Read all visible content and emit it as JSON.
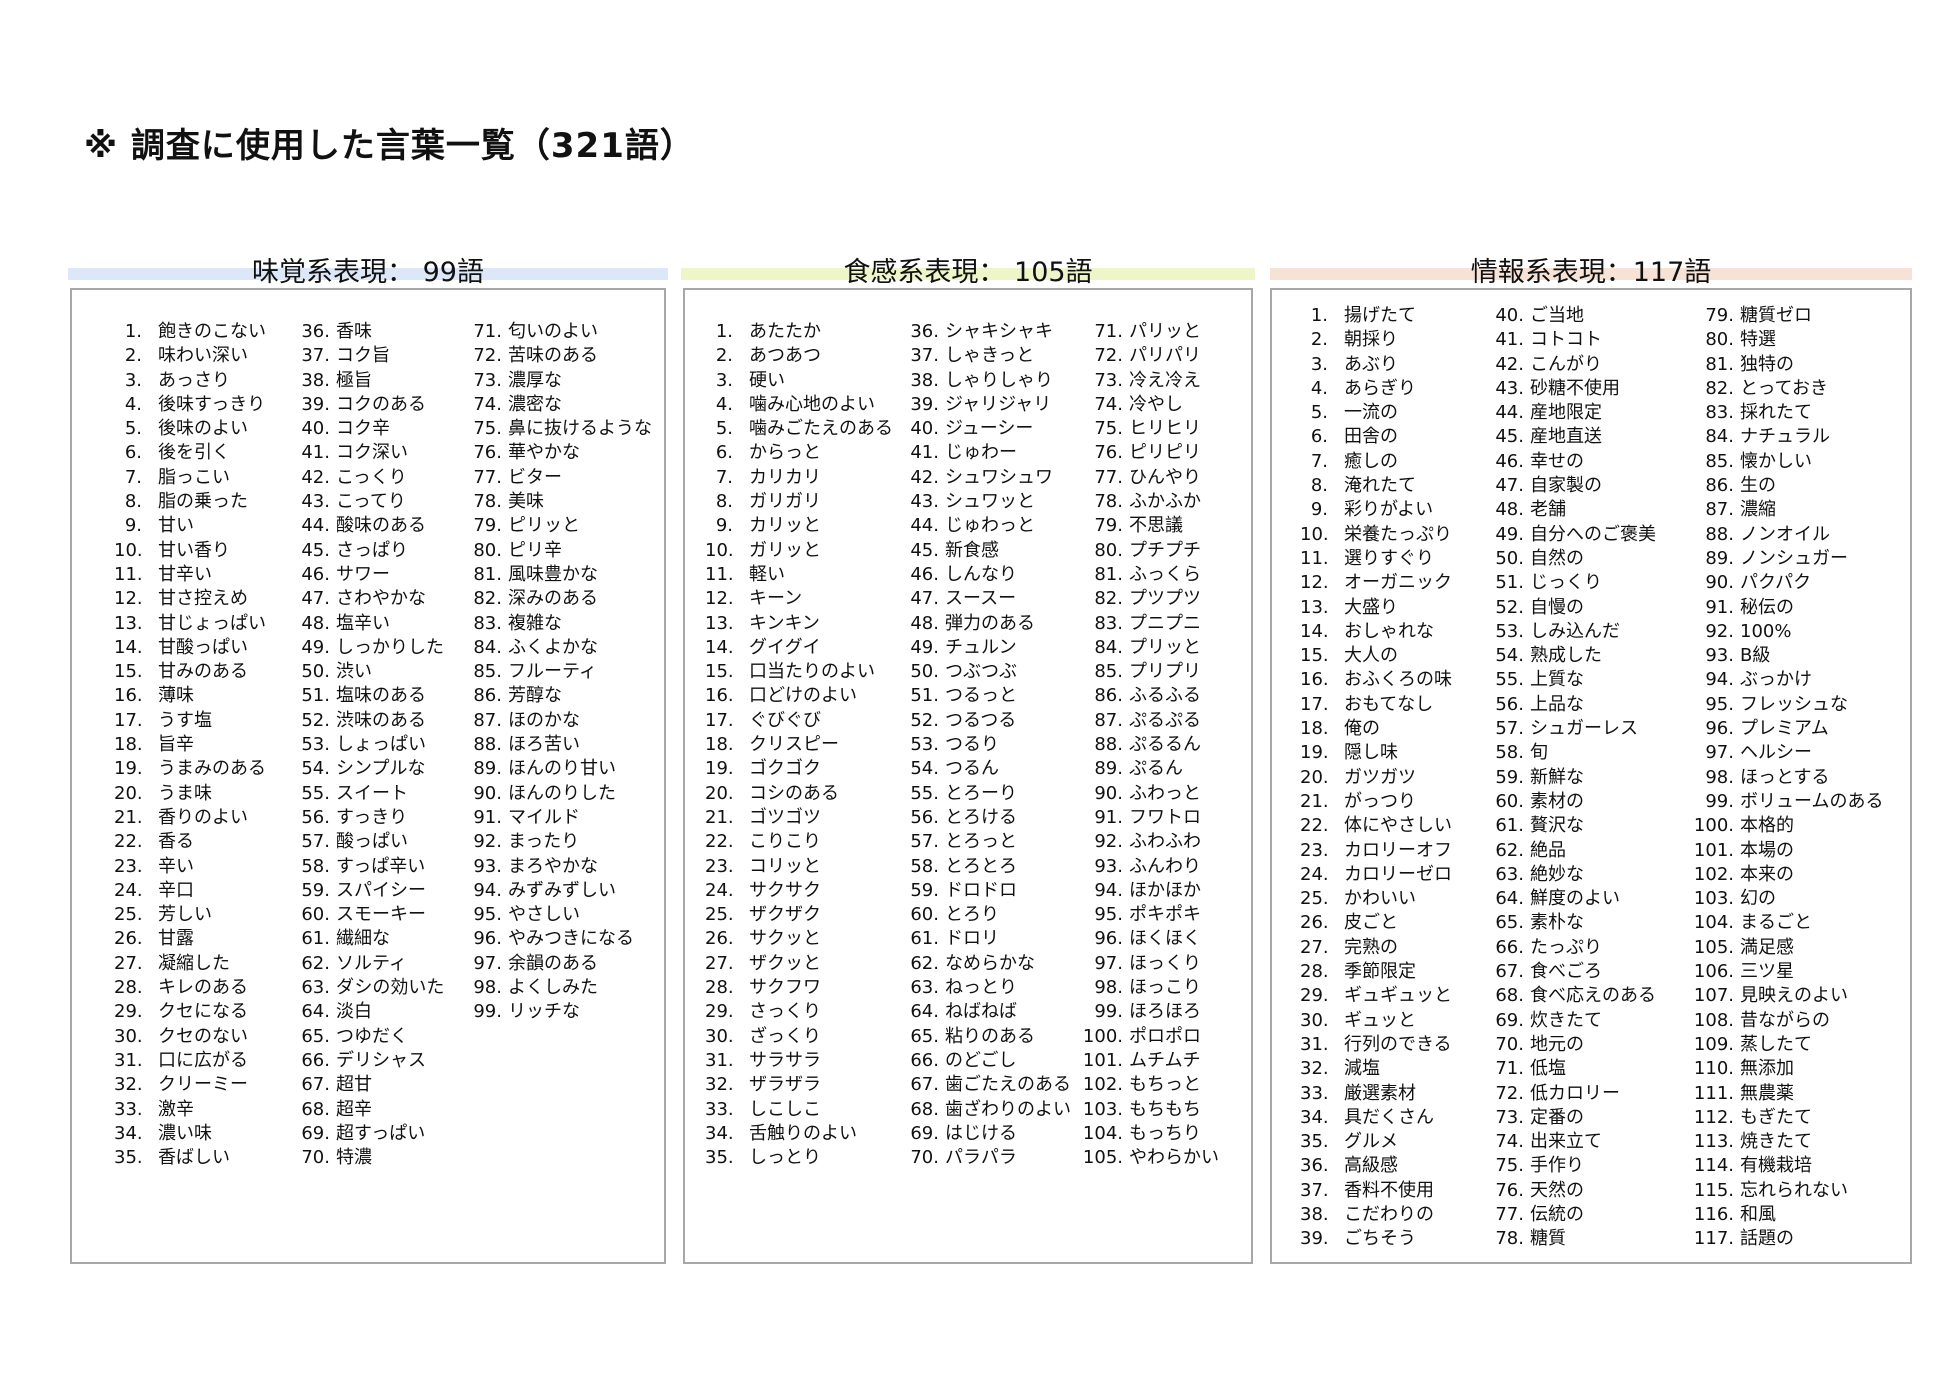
{
  "title": "※ 調査に使用した言葉一覧（321語）",
  "panels": [
    {
      "header": "味覚系表現： 99語",
      "accent": "#dce8f7",
      "columns": [
        [
          "飽きのこない",
          "味わい深い",
          "あっさり",
          "後味すっきり",
          "後味のよい",
          "後を引く",
          "脂っこい",
          "脂の乗った",
          "甘い",
          "甘い香り",
          "甘辛い",
          "甘さ控えめ",
          "甘じょっぱい",
          "甘酸っぱい",
          "甘みのある",
          "薄味",
          "うす塩",
          "旨辛",
          "うまみのある",
          "うま味",
          "香りのよい",
          "香る",
          "辛い",
          "辛口",
          "芳しい",
          "甘露",
          "凝縮した",
          "キレのある",
          "クセになる",
          "クセのない",
          "口に広がる",
          "クリーミー",
          "激辛",
          "濃い味",
          "香ばしい"
        ],
        [
          "香味",
          "コク旨",
          "極旨",
          "コクのある",
          "コク辛",
          "コク深い",
          "こっくり",
          "こってり",
          "酸味のある",
          "さっぱり",
          "サワー",
          "さわやかな",
          "塩辛い",
          "しっかりした",
          "渋い",
          "塩味のある",
          "渋味のある",
          "しょっぱい",
          "シンプルな",
          "スイート",
          "すっきり",
          "酸っぱい",
          "すっぱ辛い",
          "スパイシー",
          "スモーキー",
          "繊細な",
          "ソルティ",
          "ダシの効いた",
          "淡白",
          "つゆだく",
          "デリシャス",
          "超甘",
          "超辛",
          "超すっぱい",
          "特濃"
        ],
        [
          "匂いのよい",
          "苦味のある",
          "濃厚な",
          "濃密な",
          "鼻に抜けるような",
          "華やかな",
          "ビター",
          "美味",
          "ピリッと",
          "ピリ辛",
          "風味豊かな",
          "深みのある",
          "複雑な",
          "ふくよかな",
          "フルーティ",
          "芳醇な",
          "ほのかな",
          "ほろ苦い",
          "ほんのり甘い",
          "ほんのりした",
          "マイルド",
          "まったり",
          "まろやかな",
          "みずみずしい",
          "やさしい",
          "やみつきになる",
          "余韻のある",
          "よくしみた",
          "リッチな"
        ]
      ]
    },
    {
      "header": "食感系表現： 105語",
      "accent": "#eef5c8",
      "columns": [
        [
          "あたたか",
          "あつあつ",
          "硬い",
          "噛み心地のよい",
          "噛みごたえのある",
          "からっと",
          "カリカリ",
          "ガリガリ",
          "カリッと",
          "ガリッと",
          "軽い",
          "キーン",
          "キンキン",
          "グイグイ",
          "口当たりのよい",
          "口どけのよい",
          "ぐびぐび",
          "クリスピー",
          "ゴクゴク",
          "コシのある",
          "ゴツゴツ",
          "こりこり",
          "コリッと",
          "サクサク",
          "ザクザク",
          "サクッと",
          "ザクッと",
          "サクフワ",
          "さっくり",
          "ざっくり",
          "サラサラ",
          "ザラザラ",
          "しこしこ",
          "舌触りのよい",
          "しっとり"
        ],
        [
          "シャキシャキ",
          "しゃきっと",
          "しゃりしゃり",
          "ジャリジャリ",
          "ジューシー",
          "じゅわー",
          "シュワシュワ",
          "シュワッと",
          "じゅわっと",
          "新食感",
          "しんなり",
          "スースー",
          "弾力のある",
          "チュルン",
          "つぶつぶ",
          "つるっと",
          "つるつる",
          "つるり",
          "つるん",
          "とろーり",
          "とろける",
          "とろっと",
          "とろとろ",
          "ドロドロ",
          "とろり",
          "ドロリ",
          "なめらかな",
          "ねっとり",
          "ねばねば",
          "粘りのある",
          "のどごし",
          "歯ごたえのある",
          "歯ざわりのよい",
          "はじける",
          "パラパラ"
        ],
        [
          "パリッと",
          "パリパリ",
          "冷え冷え",
          "冷やし",
          "ヒリヒリ",
          "ピリピリ",
          "ひんやり",
          "ふかふか",
          "不思議",
          "プチプチ",
          "ふっくら",
          "プツプツ",
          "プニプニ",
          "プリッと",
          "プリプリ",
          "ふるふる",
          "ぷるぷる",
          "ぷるるん",
          "ぷるん",
          "ふわっと",
          "フワトロ",
          "ふわふわ",
          "ふんわり",
          "ほかほか",
          "ポキポキ",
          "ほくほく",
          "ほっくり",
          "ほっこり",
          "ほろほろ",
          "ポロポロ",
          "ムチムチ",
          "もちっと",
          "もちもち",
          "もっちり",
          "やわらかい"
        ]
      ]
    },
    {
      "header": "情報系表現：117語",
      "accent": "#f7e3d6",
      "columns": [
        [
          "揚げたて",
          "朝採り",
          "あぶり",
          "あらぎり",
          "一流の",
          "田舎の",
          "癒しの",
          "淹れたて",
          "彩りがよい",
          "栄養たっぷり",
          "選りすぐり",
          "オーガニック",
          "大盛り",
          "おしゃれな",
          "大人の",
          "おふくろの味",
          "おもてなし",
          "俺の",
          "隠し味",
          "ガツガツ",
          "がっつり",
          "体にやさしい",
          "カロリーオフ",
          "カロリーゼロ",
          "かわいい",
          "皮ごと",
          "完熟の",
          "季節限定",
          "ギュギュッと",
          "ギュッと",
          "行列のできる",
          "減塩",
          "厳選素材",
          "具だくさん",
          "グルメ",
          "高級感",
          "香料不使用",
          "こだわりの",
          "ごちそう"
        ],
        [
          "ご当地",
          "コトコト",
          "こんがり",
          "砂糖不使用",
          "産地限定",
          "産地直送",
          "幸せの",
          "自家製の",
          "老舗",
          "自分へのご褒美",
          "自然の",
          "じっくり",
          "自慢の",
          "しみ込んだ",
          "熟成した",
          "上質な",
          "上品な",
          "シュガーレス",
          "旬",
          "新鮮な",
          "素材の",
          "贅沢な",
          "絶品",
          "絶妙な",
          "鮮度のよい",
          "素朴な",
          "たっぷり",
          "食べごろ",
          "食べ応えのある",
          "炊きたて",
          "地元の",
          "低塩",
          "低カロリー",
          "定番の",
          "出来立て",
          "手作り",
          "天然の",
          "伝統の",
          "糖質"
        ],
        [
          "糖質ゼロ",
          "特選",
          "独特の",
          "とっておき",
          "採れたて",
          "ナチュラル",
          "懐かしい",
          "生の",
          "濃縮",
          "ノンオイル",
          "ノンシュガー",
          "パクパク",
          "秘伝の",
          "100%",
          "B級",
          "ぶっかけ",
          "フレッシュな",
          "プレミアム",
          "ヘルシー",
          "ほっとする",
          "ボリュームのある",
          "本格的",
          "本場の",
          "本来の",
          "幻の",
          "まるごと",
          "満足感",
          "三ツ星",
          "見映えのよい",
          "昔ながらの",
          "蒸したて",
          "無添加",
          "無農薬",
          "もぎたて",
          "焼きたて",
          "有機栽培",
          "忘れられない",
          "和風",
          "話題の"
        ]
      ]
    }
  ]
}
